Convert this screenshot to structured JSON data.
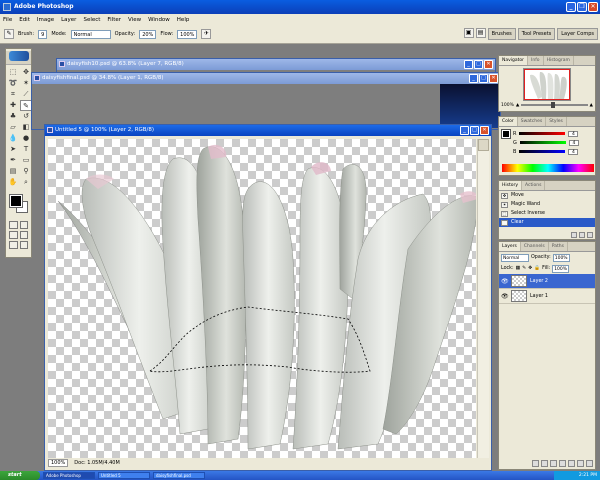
{
  "app": {
    "title": "Adobe Photoshop"
  },
  "menu": [
    "File",
    "Edit",
    "Image",
    "Layer",
    "Select",
    "Filter",
    "View",
    "Window",
    "Help"
  ],
  "options": {
    "brush_label": "Brush:",
    "brush_size": "9",
    "mode_label": "Mode:",
    "mode_value": "Normal",
    "opacity_label": "Opacity:",
    "opacity_value": "20%",
    "flow_label": "Flow:",
    "flow_value": "100%",
    "wells": [
      "Brushes",
      "Tool Presets",
      "Layer Comps"
    ]
  },
  "documents": {
    "daisy10": "daisyfish10.psd @ 63.8% (Layer 7, RGB/8)",
    "daisyfinal": "daisyfishfinal.psd @ 34.8% (Layer 1, RGB/8)",
    "untitled": "Untitled 5 @ 100% (Layer 2, RGB/8)",
    "zoom": "100%",
    "doc_size": "Doc: 1.05M/4.40M"
  },
  "navigator": {
    "tabs": [
      "Navigator",
      "Info",
      "Histogram"
    ],
    "zoom": "100%"
  },
  "color": {
    "tabs": [
      "Color",
      "Swatches",
      "Styles"
    ],
    "rows": [
      {
        "label": "R",
        "value": "4"
      },
      {
        "label": "G",
        "value": "4"
      },
      {
        "label": "B",
        "value": "4"
      }
    ]
  },
  "history": {
    "tabs": [
      "History",
      "Actions"
    ],
    "items": [
      "Move",
      "Magic Wand",
      "Select Inverse",
      "Clear"
    ]
  },
  "layers": {
    "tabs": [
      "Layers",
      "Channels",
      "Paths"
    ],
    "blend_mode": "Normal",
    "opacity_label": "Opacity:",
    "opacity_value": "100%",
    "lock_label": "Lock:",
    "fill_label": "Fill:",
    "fill_value": "100%",
    "items": [
      {
        "name": "Layer 2",
        "active": true
      },
      {
        "name": "Layer 1",
        "active": false
      }
    ]
  },
  "taskbar": {
    "start": "start",
    "tasks": [
      "Adobe Photoshop",
      "Untitled 5",
      "daisyfishfinal.psd"
    ],
    "clock": "2:21 PM"
  },
  "colors": {
    "accent": "#0a44c0",
    "canvas_check": "#cccccc",
    "foreground": "#000000"
  }
}
